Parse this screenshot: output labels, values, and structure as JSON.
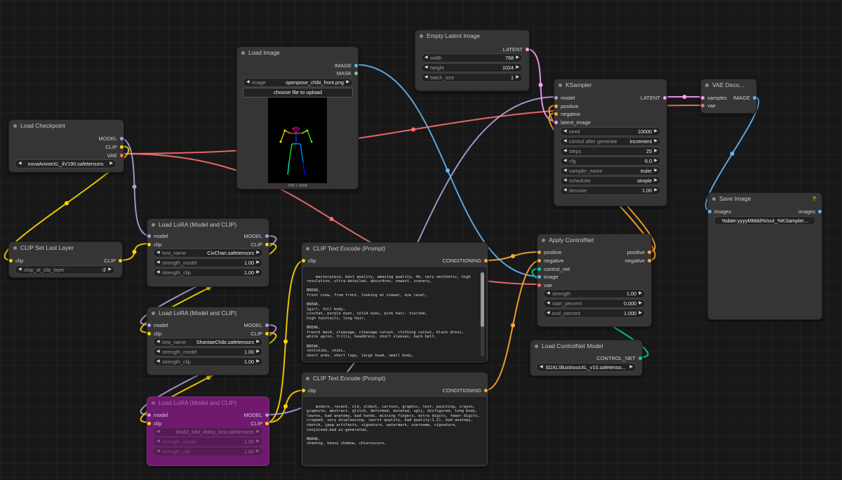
{
  "colors": {
    "model": "#b39ddb",
    "clip": "#ffd500",
    "vae": "#ff6e6e",
    "latent": "#ff9cf9",
    "image": "#64b5f6",
    "conditioning": "#ffa931",
    "control_net": "#00d78d",
    "mask": "#81c784",
    "bypass": "#6f1a6f"
  },
  "nodes": {
    "load_checkpoint": {
      "title": "Load Checkpoint",
      "out_model": "MODEL",
      "out_clip": "CLIP",
      "out_vae": "VAE",
      "ckpt_name": "novaAnimeXL_ilV190.safetensors"
    },
    "clip_set_last_layer": {
      "title": "CLIP Set Last Layer",
      "in_clip": "clip",
      "out_clip": "CLIP",
      "label": "stop_at_clip_layer",
      "value": "-2"
    },
    "load_image": {
      "title": "Load Image",
      "out_image": "IMAGE",
      "out_mask": "MASK",
      "label": "image",
      "value": "openpose_chibi_front.png",
      "upload": "choose file to upload",
      "caption": "704 × 1024"
    },
    "empty_latent": {
      "title": "Empty Latent Image",
      "out_latent": "LATENT",
      "widgets": [
        {
          "label": "width",
          "value": "768"
        },
        {
          "label": "height",
          "value": "1024"
        },
        {
          "label": "batch_size",
          "value": "1"
        }
      ]
    },
    "ksampler": {
      "title": "KSampler",
      "in_model": "model",
      "in_positive": "positive",
      "in_negative": "negative",
      "in_latent": "latent_image",
      "out_latent": "LATENT",
      "widgets": [
        {
          "label": "seed",
          "value": "10000"
        },
        {
          "label": "control after generate",
          "value": "increment"
        },
        {
          "label": "steps",
          "value": "25"
        },
        {
          "label": "cfg",
          "value": "6.0"
        },
        {
          "label": "sampler_name",
          "value": "euler"
        },
        {
          "label": "scheduler",
          "value": "simple"
        },
        {
          "label": "denoise",
          "value": "1.00"
        }
      ]
    },
    "vae_decode": {
      "title": "VAE Deco...",
      "in_samples": "samples",
      "in_vae": "vae",
      "out_image": "IMAGE"
    },
    "save_image": {
      "title": "Save Image",
      "help": "?",
      "in_images": "images",
      "out_images": "images",
      "value": "%date:yyyyMMdd%/out_%KSampler..."
    },
    "lora1": {
      "title": "Load LoRA (Model and CLIP)",
      "in_model": "model",
      "in_clip": "clip",
      "out_model": "MODEL",
      "out_clip": "CLIP",
      "widgets": [
        {
          "label": "lora_name",
          "value": "CivChan.safetensors"
        },
        {
          "label": "strength_model",
          "value": "1.00"
        },
        {
          "label": "strength_clip",
          "value": "1.00"
        }
      ]
    },
    "lora2": {
      "title": "Load LoRA (Model and CLIP)",
      "in_model": "model",
      "in_clip": "clip",
      "out_model": "MODEL",
      "out_clip": "CLIP",
      "widgets": [
        {
          "label": "lora_name",
          "value": "ShantaeChibi.safetensors"
        },
        {
          "label": "strength_model",
          "value": "1.00"
        },
        {
          "label": "strength_clip",
          "value": "1.00"
        }
      ]
    },
    "lora3": {
      "title": "Load LoRA (Model and CLIP)",
      "in_model": "model",
      "in_clip": "clip",
      "out_model": "MODEL",
      "out_clip": "CLIP",
      "widgets": [
        {
          "label": "",
          "value": "dmd2_sdxl_4step_lora.safetensors"
        },
        {
          "label": "strength_model",
          "value": "1.00"
        },
        {
          "label": "strength_clip",
          "value": "1.00"
        }
      ]
    },
    "clip_pos": {
      "title": "CLIP Text Encode (Prompt)",
      "in_clip": "clip",
      "out": "CONDITIONING",
      "text": "masterpiece, best quality, amazing quality, 4k, very aesthetic, high resolution, ultra-detailed, absurdres, newest, scenery,\n\nBREAK,\nfront view, from front, looking at viewer, eye level,\n\nBREAK,\n1girl, full body,\ncivchan, purple eyes, solid eyes, pink hair, tsurime,\nhigh twintails, long hair,\n\nBREAK,\nfrench maid, cleavage, cleavage cutout, clothing cutout, black dress, white apron, frills, headdress, short sleeves, back belt,\n\nBREAK,\nshntchibi, chibi,\nshort arms, short legs, large head, small body,"
    },
    "clip_neg": {
      "title": "CLIP Text Encode (Prompt)",
      "in_clip": "clip",
      "out": "CONDITIONING",
      "text": "modern, recent, old, oldest, cartoon, graphic, text, painting, crayon, graphite, abstract, glitch, deformed, mutated, ugly, disfigured, long body, lowres, bad anatomy, bad hands, missing fingers, extra digits, fewer digits, cropped, very displeasing, (worst quality, bad quality:1.2), bad anatomy, sketch, jpeg artifacts, signature, watermark, username, signature, conjoined,bad ai-generated,\n\nBREAK,\nshading, heavy shadow, chiaroscuro,"
    },
    "apply_controlnet": {
      "title": "Apply ControlNet",
      "in_positive": "positive",
      "in_negative": "negative",
      "in_control_net": "control_net",
      "in_image": "image",
      "in_vae": "vae",
      "out_positive": "positive",
      "out_negative": "negative",
      "widgets": [
        {
          "label": "strength",
          "value": "1.00"
        },
        {
          "label": "start_percent",
          "value": "0.000"
        },
        {
          "label": "end_percent",
          "value": "1.000"
        }
      ]
    },
    "load_controlnet": {
      "title": "Load ControlNet Model",
      "out": "CONTROL_NET",
      "value": "SDXL\\illustriousXL_v10.safetenso..."
    }
  }
}
